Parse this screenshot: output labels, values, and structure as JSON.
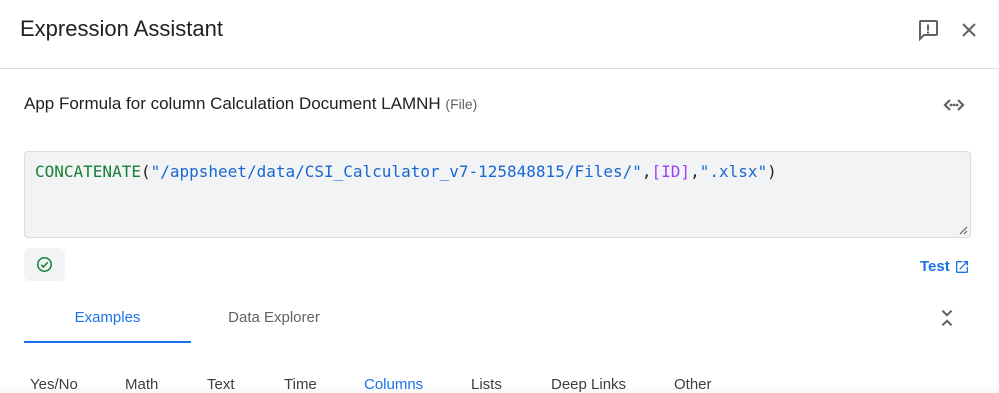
{
  "dialog": {
    "title": "Expression Assistant",
    "feedback_icon": "feedback-icon",
    "close_icon": "close-icon"
  },
  "formula": {
    "label": "App Formula for column Calculation Document LAMNH",
    "type_hint": "(File)",
    "code_icon": "code-icon",
    "expression": {
      "function": "CONCATENATE",
      "open": "(",
      "arg1": "\"/appsheet/data/CSI_Calculator_v7-125848815/Files/\"",
      "sep1": ",",
      "arg2": "[ID]",
      "sep2": ",",
      "arg3": "\".xlsx\"",
      "close": ")"
    },
    "valid_icon": "check-circle-icon",
    "test_label": "Test",
    "test_icon": "open-in-new-icon"
  },
  "tabs": [
    {
      "label": "Examples",
      "active": true
    },
    {
      "label": "Data Explorer",
      "active": false
    }
  ],
  "subtabs": [
    "Yes/No",
    "Math",
    "Text",
    "Time",
    "Columns",
    "Lists",
    "Deep Links",
    "Other"
  ],
  "active_subtab": "Columns",
  "colors": {
    "accent": "#1a73e8",
    "function": "#188038",
    "string": "#1967d2",
    "column_ref": "#a142f4",
    "valid": "#188038"
  }
}
